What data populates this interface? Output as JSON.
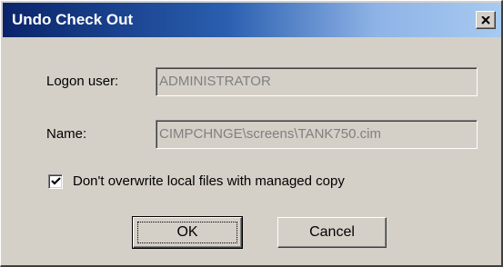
{
  "window": {
    "title": "Undo Check Out",
    "close_icon": "close-icon"
  },
  "form": {
    "logon_user_label": "Logon user:",
    "logon_user_value": "ADMINISTRATOR",
    "name_label": "Name:",
    "name_value": "CIMPCHNGE\\screens\\TANK750.cim",
    "checkbox_label": "Don't overwrite local files with managed copy",
    "checkbox_checked": true
  },
  "buttons": {
    "ok_label": "OK",
    "cancel_label": "Cancel"
  },
  "colors": {
    "dialog_face": "#d4d0c8",
    "titlebar_start": "#0a246a",
    "titlebar_end": "#a6caf0",
    "disabled_text": "#808080"
  }
}
